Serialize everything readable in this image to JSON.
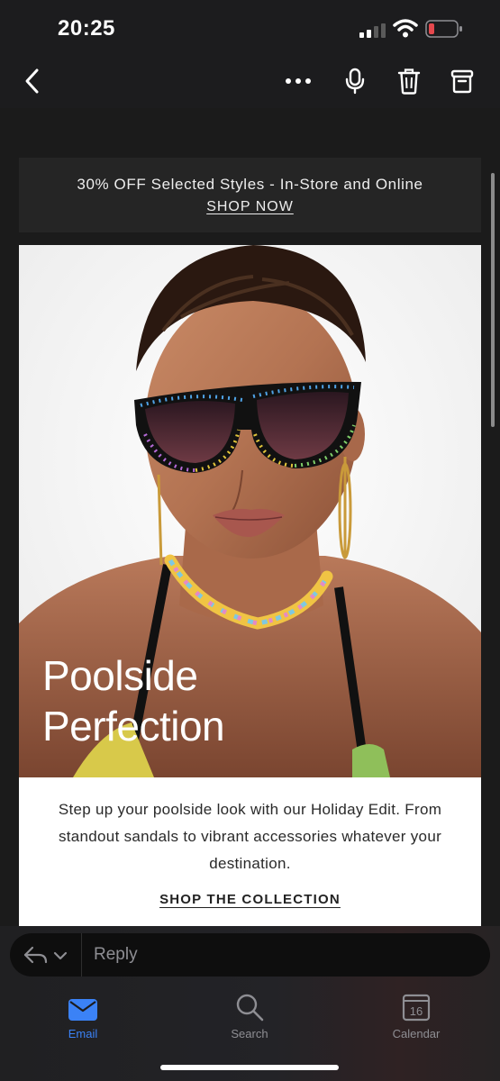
{
  "status_bar": {
    "time": "20:25",
    "icons": [
      "cellular-signal-icon",
      "wifi-icon",
      "battery-low-icon"
    ],
    "battery_color": "#e5484d"
  },
  "nav_bar": {
    "icons": [
      "back-chevron-icon",
      "more-icon",
      "microphone-icon",
      "trash-icon",
      "archive-icon"
    ]
  },
  "email": {
    "promo": {
      "text": "30% OFF Selected Styles - In-Store and Online",
      "link_label": "SHOP NOW"
    },
    "hero": {
      "title_line1": "Poolside",
      "title_line2": "Perfection"
    },
    "body": {
      "text": "Step up your poolside look with our Holiday Edit. From standout sandals to vibrant accessories whatever your destination.",
      "link_label": "SHOP THE COLLECTION"
    }
  },
  "reply_bar": {
    "placeholder": "Reply",
    "icons": [
      "reply-arrow-icon",
      "chevron-down-icon"
    ]
  },
  "tab_bar": {
    "tabs": [
      {
        "label": "Email",
        "icon": "envelope-icon",
        "active": true
      },
      {
        "label": "Search",
        "icon": "magnifier-icon",
        "active": false
      },
      {
        "label": "Calendar",
        "icon": "calendar-icon",
        "active": false
      }
    ],
    "calendar_day": "16",
    "active_color": "#3b82f6"
  }
}
